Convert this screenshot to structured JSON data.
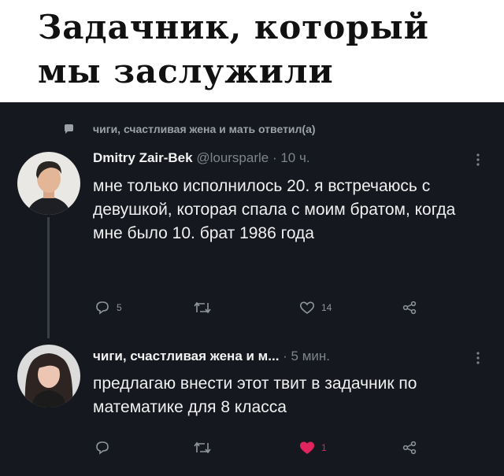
{
  "caption": {
    "line1": "Задачник, который",
    "line2": "мы заслужили"
  },
  "reply_note": "чиги, счастливая жена и мать ответил(а)",
  "tweets": [
    {
      "name": "Dmitry Zair-Bek",
      "meta": " @loursparle · 10 ч.",
      "text": "мне только исполнилось 20. я встречаюсь с девушкой, которая спала с моим братом, когда мне было 10. брат 1986 года",
      "actions": {
        "replies": "5",
        "retweets": "",
        "likes": "14"
      }
    },
    {
      "name": "чиги, счастливая жена и м...",
      "meta": " · 5 мин.",
      "text": "предлагаю внести этот твит в задачник по математике для 8 класса",
      "actions": {
        "replies": "",
        "retweets": "",
        "likes": "1"
      }
    }
  ],
  "colors": {
    "background": "#16181f",
    "text": "#f0f0f0",
    "muted": "#7d848c",
    "like_active": "#e0245e"
  },
  "icons": [
    "reply-indicator-icon",
    "more-icon",
    "reply-icon",
    "retweet-icon",
    "like-icon",
    "share-icon"
  ]
}
